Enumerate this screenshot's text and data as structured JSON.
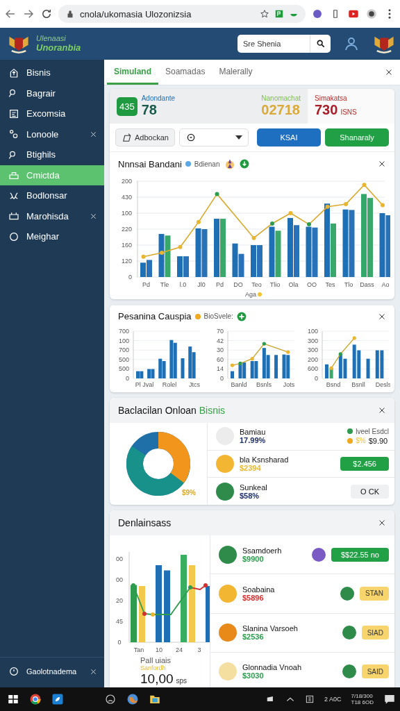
{
  "browser": {
    "url": "cnola/ukomasia Ulozonizsia"
  },
  "header": {
    "logo_line1": "Ulenaasi",
    "logo_line2": "Unoranbia",
    "search": {
      "value": "Sre Shenia"
    }
  },
  "sidebar": {
    "items": [
      {
        "label": "Bisnis",
        "selected": false,
        "closable": false
      },
      {
        "label": "Bagrair",
        "selected": false,
        "closable": false
      },
      {
        "label": "Excomsia",
        "selected": false,
        "closable": false
      },
      {
        "label": "Lonoole",
        "selected": false,
        "closable": true
      },
      {
        "label": "Btighils",
        "selected": false,
        "closable": false
      },
      {
        "label": "Cmictda",
        "selected": true,
        "closable": false
      },
      {
        "label": "Bodlonsar",
        "selected": false,
        "closable": false
      },
      {
        "label": "Marohisda",
        "selected": false,
        "closable": true
      },
      {
        "label": "Meighar",
        "selected": false,
        "closable": false
      }
    ],
    "footer": {
      "label": "Gaolotnadema",
      "closable": true
    }
  },
  "tabs": [
    {
      "label": "Simuland",
      "selected": true
    },
    {
      "label": "Soamadas",
      "selected": false
    },
    {
      "label": "Malerally",
      "selected": false
    }
  ],
  "stats": [
    {
      "kind": "badge",
      "badge": "435",
      "label": "Adondante",
      "value": "78"
    },
    {
      "kind": "plain",
      "label": "Nanomachat",
      "value": "02718"
    },
    {
      "kind": "alert",
      "label": "Simakatsa",
      "value": "730",
      "unit": "ISNS"
    }
  ],
  "toolbar": {
    "filter_button": "Adbockan",
    "buttons": [
      {
        "label": "KSAI",
        "kind": "primary"
      },
      {
        "label": "Shanaraly",
        "kind": "success"
      }
    ]
  },
  "main_chart": {
    "title": "Nnnsai Bandani",
    "legend": "Bdienan",
    "y_labels": [
      "200",
      "430",
      "100",
      "220",
      "160",
      "120",
      "0"
    ],
    "x_labels": [
      "Pd",
      "Tle",
      "l.0",
      "Jl0",
      "Pd",
      "DO",
      "Teo",
      "Tlio",
      "Ola",
      "OO",
      "Tes",
      "Tlo",
      "Dass",
      "Ao"
    ],
    "x_title": "Aga"
  },
  "compare_card": {
    "title": "Pesanina Causpia",
    "legend": "BioSvele:",
    "charts": [
      {
        "y_labels": [
          "700",
          "100",
          "700",
          "500",
          "500",
          "0"
        ],
        "x_labels": [
          "Pl Jval",
          "Rolel",
          "Jtcs"
        ]
      },
      {
        "y_labels": [
          "70",
          "42",
          "30",
          "60",
          "14",
          "0"
        ],
        "x_labels": [
          "Banld",
          "Bsnls",
          "Jots"
        ]
      },
      {
        "y_labels": [
          "100",
          "300",
          "300",
          "200",
          "600",
          "0"
        ],
        "x_labels": [
          "Bsnd",
          "Bsnll",
          "Desls"
        ]
      }
    ]
  },
  "breakdown_card": {
    "title": "Baclacilan Onloan",
    "title_accent": "Bisnis",
    "donut_label": "$9%",
    "rows": [
      {
        "kind": "legend",
        "name": "Bamiau",
        "value": "17.99%",
        "color": "#1e2f6a",
        "legend": [
          {
            "label": "lveel Esdcl",
            "color": "#2e9b4e"
          },
          {
            "label": "$%",
            "amount": "$9.90",
            "color": "#f2a81d"
          }
        ]
      },
      {
        "kind": "button",
        "name": "bla Ksnsharad",
        "value": "$2394",
        "color": "#e6b930",
        "action": "$2.456"
      },
      {
        "kind": "chip",
        "name": "Sunkeal",
        "value": "$58%",
        "color": "#1e2f6a",
        "action": "O CK"
      }
    ]
  },
  "deals_card": {
    "title": "Denlainsass",
    "chart": {
      "y_labels": [
        "00",
        "00",
        "20",
        "45",
        "0"
      ],
      "x_labels": [
        "Tan",
        "10",
        "24",
        "3"
      ]
    },
    "caption": "Pall uiais",
    "subcaption": "Sanfordh",
    "total": "10,00",
    "total_unit": "sps",
    "rows": [
      {
        "name": "Ssamdoerh",
        "price": "$9900",
        "color": "#2e9b4e",
        "kind": "primary",
        "action": "$$22.55 no"
      },
      {
        "name": "Soabaina",
        "price": "$5896",
        "color": "#d32f2f",
        "kind": "tag",
        "action": "STAN"
      },
      {
        "name": "Slanina Varsoeh",
        "price": "$2536",
        "color": "#2e9b4e",
        "kind": "tag",
        "action": "SIAD"
      },
      {
        "name": "Glonnadia Vnoah",
        "price": "$3030",
        "color": "#2e9b4e",
        "kind": "tag",
        "action": "SAID"
      }
    ]
  },
  "taskbar": {
    "tray_text": "2 A0C",
    "clock_line1": "7/18/300",
    "clock_line2": "T18 6OD"
  }
}
